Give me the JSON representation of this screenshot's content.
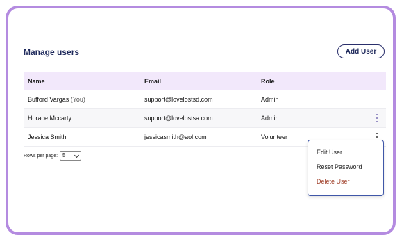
{
  "page": {
    "title": "Manage users",
    "add_button_label": "Add User"
  },
  "table": {
    "columns": [
      "Name",
      "Email",
      "Role"
    ],
    "rows": [
      {
        "name": "Bufford Vargas",
        "you_tag": "(You)",
        "email": "support@lovelostsd.com",
        "role": "Admin"
      },
      {
        "name": "Horace Mccarty",
        "email": "support@lovelostsa.com",
        "role": "Admin"
      },
      {
        "name": "Jessica Smith",
        "email": "jessicasmith@aol.com",
        "role": "Volunteer"
      }
    ]
  },
  "pagination": {
    "rows_per_page_label": "Rows per page:",
    "rows_per_page_value": "5"
  },
  "context_menu": {
    "items": [
      "Edit User",
      "Reset Password",
      "Delete User"
    ],
    "danger_color": "#a0402a"
  },
  "colors": {
    "frame": "#b48be0",
    "header_bg": "#f2e8fb",
    "title": "#1f2a5c",
    "menu_border": "#3f57a8"
  },
  "icons": [
    "kebab-menu-icon",
    "chevron-down-icon"
  ]
}
